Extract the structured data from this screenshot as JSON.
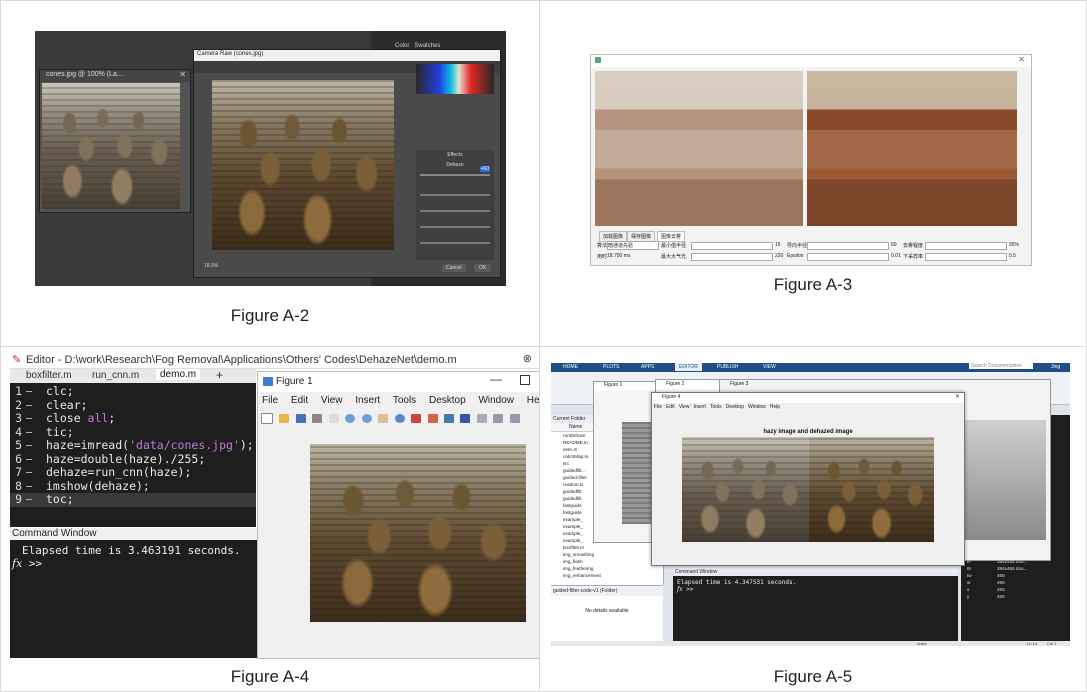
{
  "captions": {
    "a2": "Figure A-2",
    "a3": "Figure A-3",
    "a4": "Figure A-4",
    "a5": "Figure A-5"
  },
  "a2": {
    "ps_doc_title": "cones.jpg @ 100% (La...",
    "camera_raw_title": "Camera Raw (cones.jpg)",
    "panel_tabs": [
      "Color",
      "Swatches"
    ],
    "effects_label": "Effects",
    "dehaze_label": "Dehaze",
    "dehaze_value": "+60",
    "cancel": "Cancel",
    "ok": "OK",
    "zoom": "18.9%"
  },
  "a3": {
    "buttons": [
      "加载图像",
      "保存图像"
    ],
    "tab": "图像去雾",
    "row1": {
      "method_label": "算法",
      "method_value": "暗通道先验",
      "l1": "最小值半径",
      "v1": "15",
      "l2": "导向半径",
      "v2": "60",
      "l3": "去雾程度",
      "v3": "95%"
    },
    "row2": {
      "time_label": "用时",
      "time_value": "18.750 ms",
      "l1": "最大大气光",
      "v1": "220",
      "l2": "Epsilon",
      "v2": "0.01",
      "l3": "下采样率",
      "v3": "0.5"
    }
  },
  "a4": {
    "editor_title": "Editor - D:\\work\\Research\\Fog Removal\\Applications\\Others' Codes\\DehazeNet\\demo.m",
    "tabs": [
      "boxfilter.m",
      "run_cnn.m",
      "demo.m"
    ],
    "code_lines": [
      {
        "n": "1",
        "t": "clc;"
      },
      {
        "n": "2",
        "t": "clear;"
      },
      {
        "n": "3",
        "t": "close all;"
      },
      {
        "n": "4",
        "t": "tic;"
      },
      {
        "n": "5",
        "t": "haze=imread('data/cones.jpg');"
      },
      {
        "n": "6",
        "t": "haze=double(haze)./255;"
      },
      {
        "n": "7",
        "t": "dehaze=run_cnn(haze);"
      },
      {
        "n": "8",
        "t": "imshow(dehaze);"
      },
      {
        "n": "9",
        "t": "toc;"
      }
    ],
    "cmd_title": "Command Window",
    "cmd_output": "Elapsed time is 3.463191 seconds.",
    "prompt": ">>",
    "fx": "fx",
    "figure_title": "Figure 1",
    "figure_menu": [
      "File",
      "Edit",
      "View",
      "Insert",
      "Tools",
      "Desktop",
      "Window",
      "Help"
    ]
  },
  "a5": {
    "ribbon_tabs": [
      "HOME",
      "PLOTS",
      "APPS",
      "EDITOR",
      "PUBLISH",
      "VIEW"
    ],
    "search_placeholder": "Search Documentation",
    "user": "Jing",
    "fig_titles": [
      "Figure 1",
      "Figure 2",
      "Figure 3",
      "Figure 4"
    ],
    "fig_menu": [
      "File",
      "Edit",
      "View",
      "Insert",
      "Tools",
      "Desktop",
      "Window",
      "Help"
    ],
    "plot_title": "hazy image and dehazed image",
    "current_folder": "Current Folder",
    "name_col": "Name",
    "files": [
      "runDehaze",
      "README.m",
      "estA.m",
      "calcSMap.m",
      "src",
      "guidedfilt...",
      "guided-filter",
      "readme.tx",
      "guidedfilt",
      "guidedfilt",
      "fastguide",
      "fastguide",
      "example_",
      "example_",
      "example_",
      "example_",
      "boxfilter.m",
      "img_smoothing",
      "img_flash",
      "img_feathering",
      "img_enhancement"
    ],
    "folder_label": "guided-filter-code-v1 (Folder)",
    "no_details": "No details available",
    "cmd_title": "Command Window",
    "cmd_output": "Elapsed time is 4.347531 seconds.",
    "workspace": [
      {
        "k": "th",
        "v": "384"
      },
      {
        "k": "tP",
        "v": "384x465 dou..."
      },
      {
        "k": "t6",
        "v": "384x465 dou..."
      },
      {
        "k": "tw",
        "v": "465"
      },
      {
        "k": "w",
        "v": "465"
      },
      {
        "k": "x",
        "v": "465"
      },
      {
        "k": "y",
        "v": "465"
      }
    ],
    "status_left": "script",
    "status_ln": "Ln 14",
    "status_col": "Col 1"
  }
}
